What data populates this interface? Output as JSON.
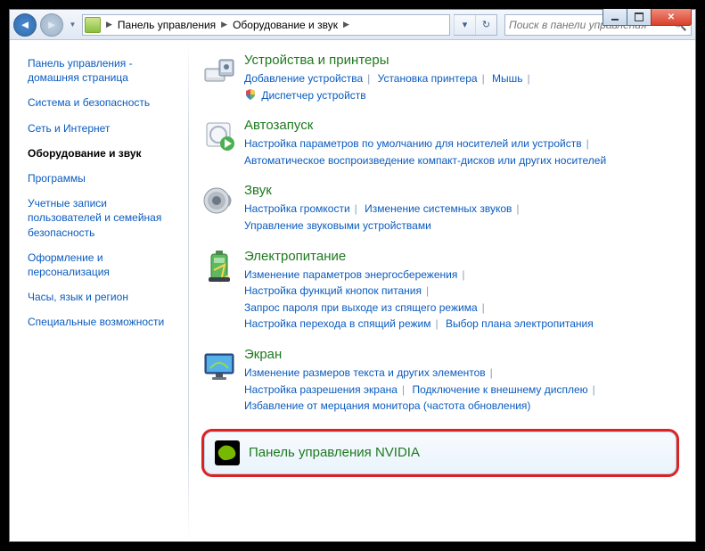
{
  "breadcrumbs": {
    "root": "Панель управления",
    "current": "Оборудование и звук"
  },
  "search": {
    "placeholder": "Поиск в панели управления"
  },
  "sidebar": {
    "items": [
      {
        "label": "Панель управления - домашняя страница",
        "active": false
      },
      {
        "label": "Система и безопасность",
        "active": false
      },
      {
        "label": "Сеть и Интернет",
        "active": false
      },
      {
        "label": "Оборудование и звук",
        "active": true
      },
      {
        "label": "Программы",
        "active": false
      },
      {
        "label": "Учетные записи пользователей и семейная безопасность",
        "active": false
      },
      {
        "label": "Оформление и персонализация",
        "active": false
      },
      {
        "label": "Часы, язык и регион",
        "active": false
      },
      {
        "label": "Специальные возможности",
        "active": false
      }
    ]
  },
  "categories": [
    {
      "id": "devices",
      "title": "Устройства и принтеры",
      "links": [
        {
          "label": "Добавление устройства"
        },
        {
          "label": "Установка принтера"
        },
        {
          "label": "Мышь"
        },
        {
          "label": "Диспетчер устройств",
          "shield": true
        }
      ]
    },
    {
      "id": "autoplay",
      "title": "Автозапуск",
      "links": [
        {
          "label": "Настройка параметров по умолчанию для носителей или устройств"
        },
        {
          "label": "Автоматическое воспроизведение компакт-дисков или других носителей"
        }
      ]
    },
    {
      "id": "sound",
      "title": "Звук",
      "links": [
        {
          "label": "Настройка громкости"
        },
        {
          "label": "Изменение системных звуков"
        },
        {
          "label": "Управление звуковыми устройствами"
        }
      ]
    },
    {
      "id": "power",
      "title": "Электропитание",
      "links": [
        {
          "label": "Изменение параметров энергосбережения"
        },
        {
          "label": "Настройка функций кнопок питания"
        },
        {
          "label": "Запрос пароля при выходе из спящего режима"
        },
        {
          "label": "Настройка перехода в спящий режим"
        },
        {
          "label": "Выбор плана электропитания"
        }
      ]
    },
    {
      "id": "display",
      "title": "Экран",
      "links": [
        {
          "label": "Изменение размеров текста и других элементов"
        },
        {
          "label": "Настройка разрешения экрана"
        },
        {
          "label": "Подключение к внешнему дисплею"
        },
        {
          "label": "Избавление от мерцания монитора (частота обновления)"
        }
      ]
    }
  ],
  "nvidia": {
    "title": "Панель управления NVIDIA"
  }
}
